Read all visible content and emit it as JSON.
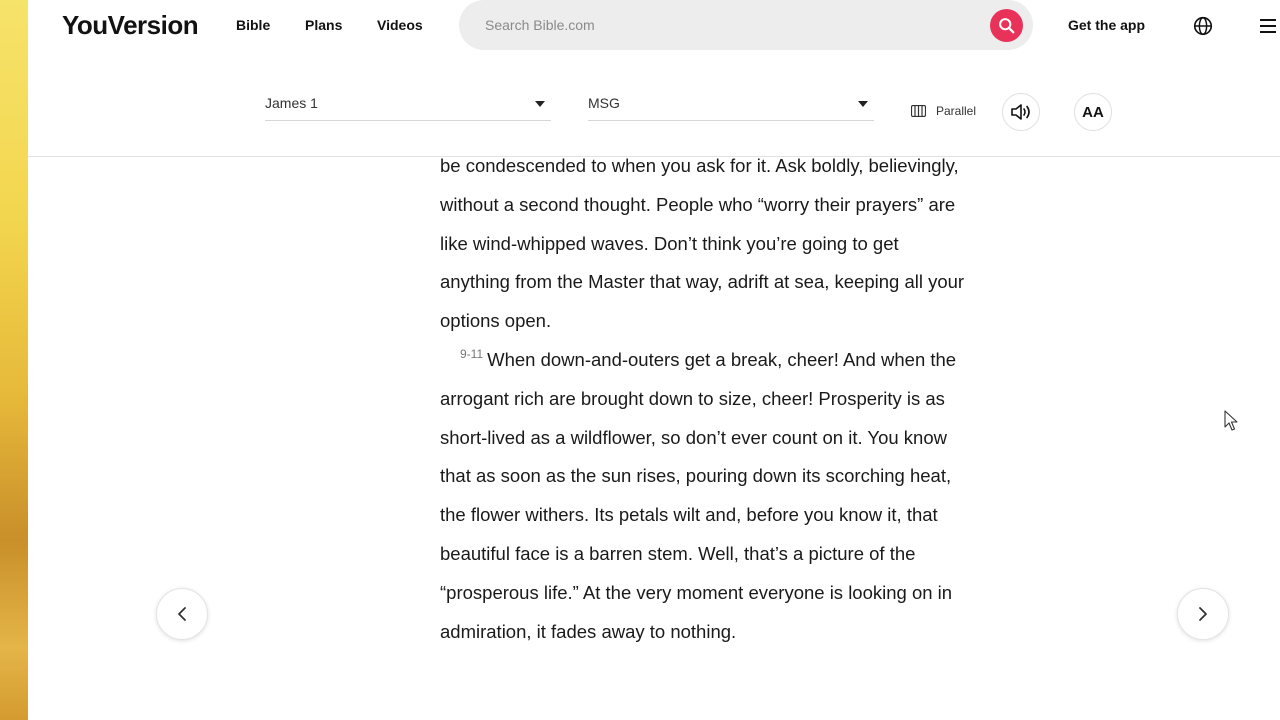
{
  "nav": {
    "logo": "YouVersion",
    "links": [
      "Bible",
      "Plans",
      "Videos"
    ],
    "search_placeholder": "Search Bible.com",
    "get_app": "Get the app"
  },
  "toolbar": {
    "book_chapter": "James 1",
    "version": "MSG",
    "parallel_label": "Parallel",
    "font_size_label": "AA"
  },
  "reader": {
    "para1": "be condescended to when you ask for it. Ask boldly, believingly, without a second thought. People who “worry their prayers” are like wind-whipped waves. Don’t think you’re going to get anything from the Master that way, adrift at sea, keeping all your options open.",
    "verse2_num": "9-11",
    "para2": "When down-and-outers get a break, cheer! And when the arrogant rich are brought down to size, cheer! Prosperity is as short-lived as a wildflower, so don’t ever count on it. You know that as soon as the sun rises, pouring down its scorching heat, the flower withers. Its petals wilt and, before you know it, that beautiful face is a barren stem. Well, that’s a picture of the “prosperous life.” At the very moment everyone is looking on in admiration, it fades away to nothing."
  },
  "colors": {
    "accent": "#e8325a",
    "text": "#121212"
  }
}
